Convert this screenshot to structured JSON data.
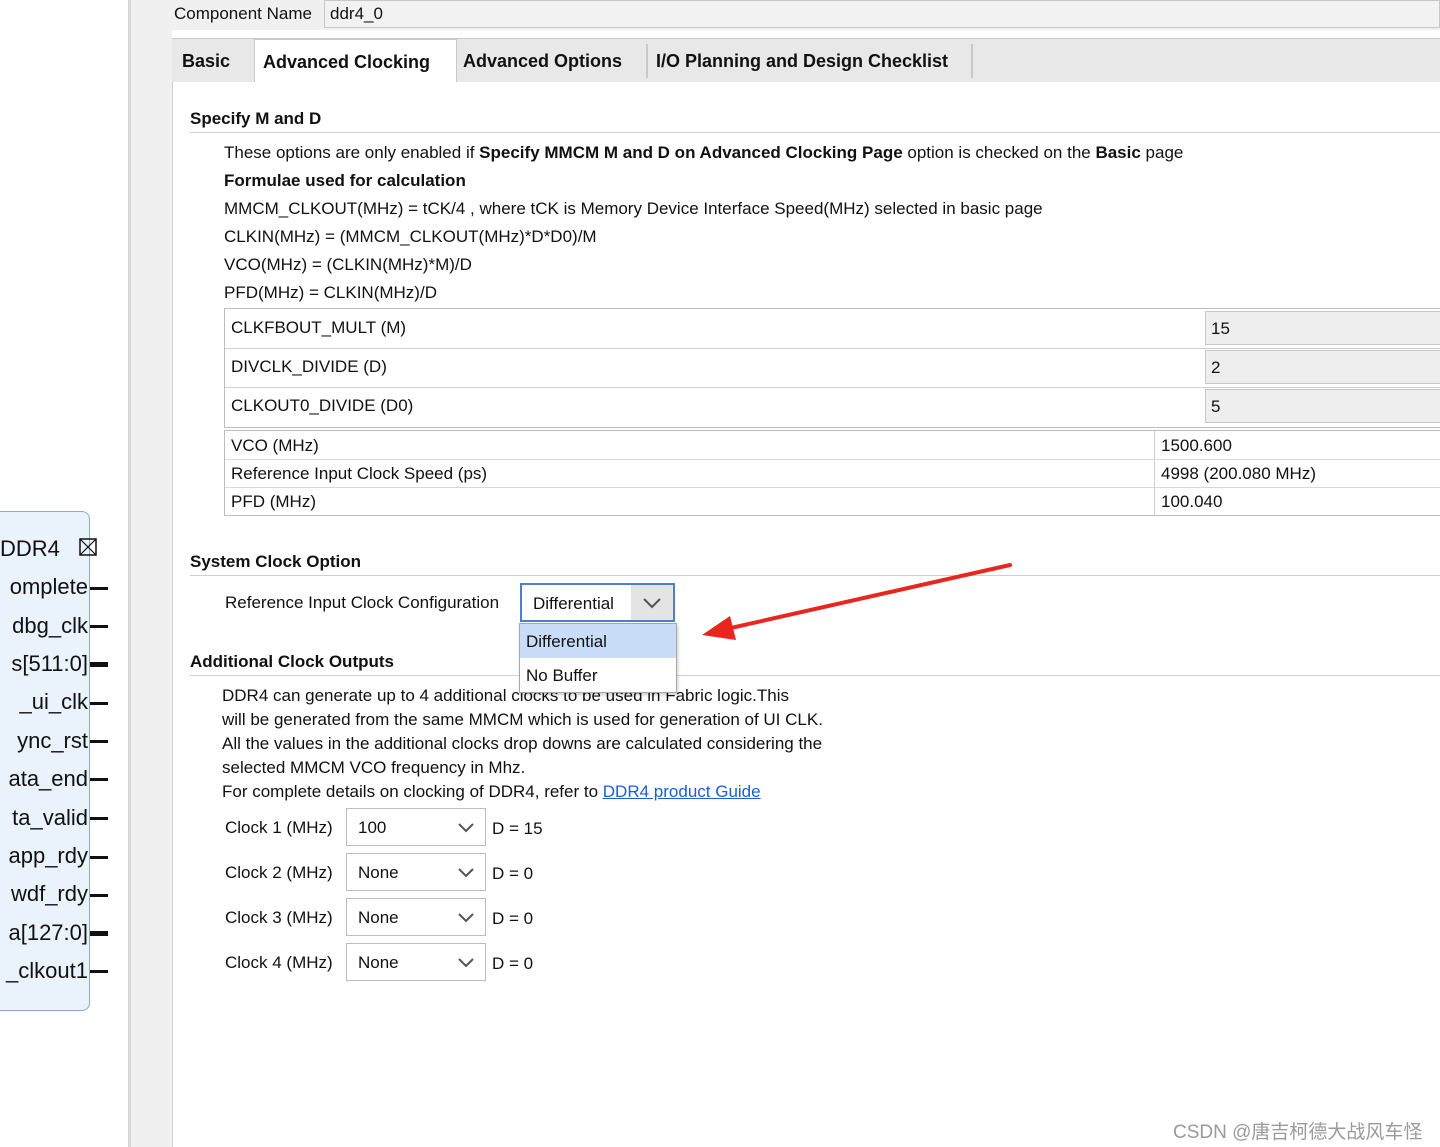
{
  "block": {
    "title": "DDR4",
    "ports": [
      "omplete",
      "dbg_clk",
      "s[511:0]",
      "_ui_clk",
      "ync_rst",
      "ata_end",
      "ta_valid",
      "app_rdy",
      "wdf_rdy",
      "a[127:0]",
      "_clkout1"
    ]
  },
  "component": {
    "label": "Component Name",
    "value": "ddr4_0"
  },
  "tabs": [
    "Basic",
    "Advanced Clocking",
    "Advanced Options",
    "I/O Planning and Design Checklist"
  ],
  "active_tab": "Advanced Clocking",
  "specify": {
    "title": "Specify M and D",
    "note_pre": "These options are only enabled if ",
    "note_bold1": "Specify MMCM M and D on Advanced Clocking Page",
    "note_mid": " option is checked on the ",
    "note_bold2": "Basic",
    "note_post": " page",
    "formulae_title": "Formulae used for calculation",
    "formulae": [
      "MMCM_CLKOUT(MHz) = tCK/4 , where tCK is Memory Device Interface Speed(MHz) selected in basic page",
      "CLKIN(MHz) = (MMCM_CLKOUT(MHz)*D*D0)/M",
      "VCO(MHz) = (CLKIN(MHz)*M)/D",
      "PFD(MHz) = CLKIN(MHz)/D"
    ],
    "params": [
      {
        "label": "CLKFBOUT_MULT (M)",
        "value": "15"
      },
      {
        "label": "DIVCLK_DIVIDE (D)",
        "value": "2"
      },
      {
        "label": "CLKOUT0_DIVIDE (D0)",
        "value": "5"
      }
    ],
    "results": [
      {
        "label": "VCO (MHz)",
        "value": "1500.600"
      },
      {
        "label": "Reference Input Clock Speed (ps)",
        "value": "4998 (200.080 MHz)"
      },
      {
        "label": "PFD (MHz)",
        "value": "100.040"
      }
    ]
  },
  "sysclk": {
    "title": "System Clock Option",
    "label": "Reference Input Clock Configuration",
    "selected": "Differential",
    "options": [
      "Differential",
      "No Buffer"
    ]
  },
  "additional": {
    "title": "Additional Clock Outputs",
    "lines": [
      "DDR4 can generate up to 4 additional clocks to be used in Fabric logic.This",
      "will be generated from the same MMCM which is used for generation of UI CLK.",
      "All the values in the additional clocks drop downs are calculated considering the",
      "selected MMCM VCO frequency in Mhz."
    ],
    "details_pre": "For complete details on clocking of DDR4, refer to ",
    "details_link": "DDR4 product Guide",
    "clocks": [
      {
        "label": "Clock 1 (MHz)",
        "value": "100",
        "d": "D = 15"
      },
      {
        "label": "Clock 2 (MHz)",
        "value": "None",
        "d": "D = 0"
      },
      {
        "label": "Clock 3 (MHz)",
        "value": "None",
        "d": "D = 0"
      },
      {
        "label": "Clock 4 (MHz)",
        "value": "None",
        "d": "D = 0"
      }
    ]
  },
  "watermark": "CSDN @唐吉柯德大战风车怪",
  "colors": {
    "accent": "#4a7fd0",
    "selection": "#c9dcf8",
    "link": "#1a5fd6",
    "arrow": "#e8261f"
  }
}
